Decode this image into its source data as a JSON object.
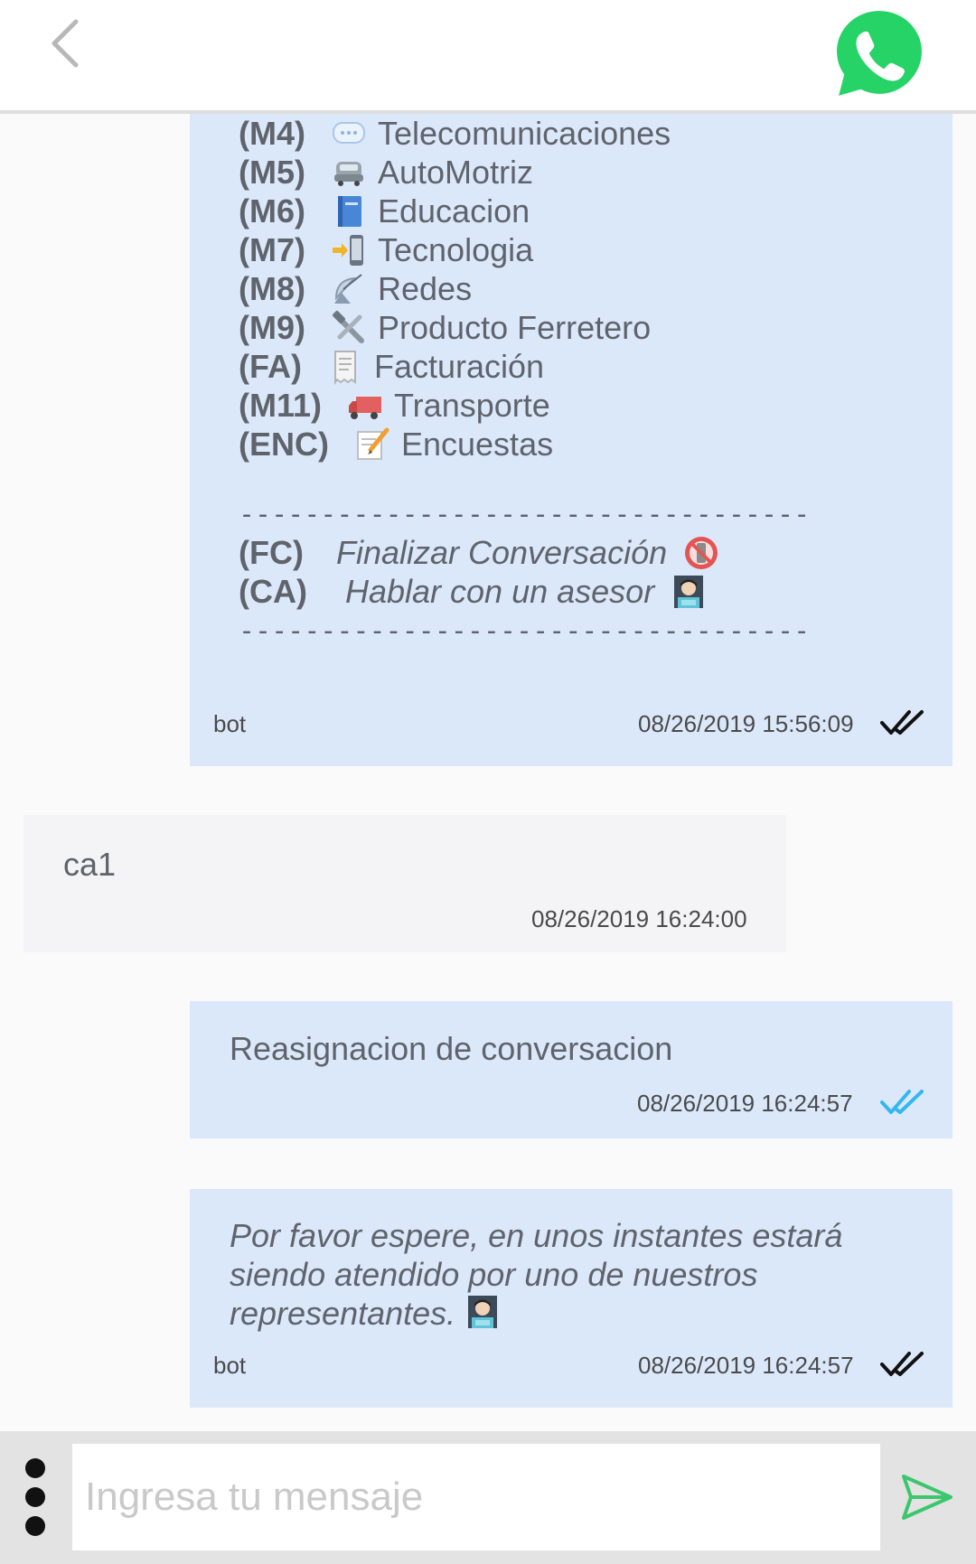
{
  "header": {
    "back_icon": "chevron-left-icon",
    "whatsapp_icon": "whatsapp-icon",
    "whatsapp_color": "#25d366"
  },
  "messages": {
    "menu": {
      "items": [
        {
          "code": "(M4)",
          "icon": "speech-balloon-icon",
          "label": "Telecomunicaciones"
        },
        {
          "code": "(M5)",
          "icon": "car-icon",
          "label": "AutoMotriz"
        },
        {
          "code": "(M6)",
          "icon": "book-icon",
          "label": "Educacion"
        },
        {
          "code": "(M7)",
          "icon": "mobile-arrow-icon",
          "label": "Tecnologia"
        },
        {
          "code": "(M8)",
          "icon": "satellite-antenna-icon",
          "label": "Redes"
        },
        {
          "code": "(M9)",
          "icon": "hammer-wrench-icon",
          "label": "Producto Ferretero"
        },
        {
          "code": "(FA)",
          "icon": "receipt-icon",
          "label": "Facturación"
        },
        {
          "code": "(M11)",
          "icon": "truck-icon",
          "label": "Transporte"
        },
        {
          "code": "(ENC)",
          "icon": "memo-icon",
          "label": "Encuestas"
        }
      ],
      "divider": "-----------------------------------",
      "options": [
        {
          "code": "(FC)",
          "label": "Finalizar Conversación",
          "icon": "no-mobile-phones-icon"
        },
        {
          "code": "(CA)",
          "label": "Hablar con un asesor",
          "icon": "technologist-icon"
        }
      ],
      "sender": "bot",
      "timestamp": "08/26/2019 15:56:09",
      "status": "delivered"
    },
    "user_reply": {
      "text": "ca1",
      "timestamp": "08/26/2019 16:24:00"
    },
    "reassign": {
      "text": "Reasignacion de conversacion",
      "timestamp": "08/26/2019 16:24:57",
      "status": "read",
      "read_color": "#34b7f1"
    },
    "wait": {
      "text": " Por favor espere, en unos instantes estará siendo atendido por uno de nuestros representantes.",
      "icon": "technologist-icon",
      "sender": "bot",
      "timestamp": "08/26/2019 16:24:57",
      "status": "delivered"
    }
  },
  "composer": {
    "placeholder": "Ingresa tu mensaje",
    "value": "",
    "more_icon": "vertical-dots-icon",
    "send_icon": "send-icon",
    "send_color": "#3cc66d"
  }
}
